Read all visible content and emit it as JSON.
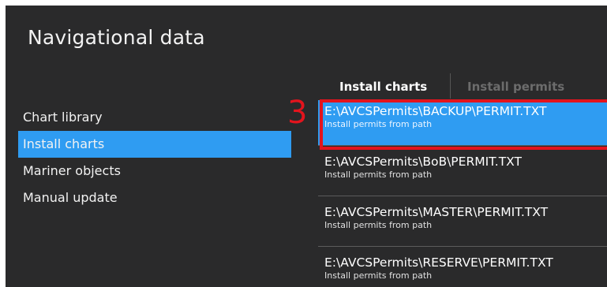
{
  "window": {
    "title": "Navigational data"
  },
  "nav": {
    "items": [
      {
        "label": "Chart library",
        "active": false
      },
      {
        "label": "Install charts",
        "active": true
      },
      {
        "label": "Mariner objects",
        "active": false
      },
      {
        "label": "Manual update",
        "active": false
      }
    ]
  },
  "tabs": [
    {
      "label": "Install charts",
      "active": true
    },
    {
      "label": "Install permits",
      "active": false
    }
  ],
  "permits": [
    {
      "path": "E:\\AVCSPermits\\BACKUP\\PERMIT.TXT",
      "subtitle": "Install permits from path",
      "selected": true
    },
    {
      "path": "E:\\AVCSPermits\\BoB\\PERMIT.TXT",
      "subtitle": "Install permits from path",
      "selected": false
    },
    {
      "path": "E:\\AVCSPermits\\MASTER\\PERMIT.TXT",
      "subtitle": "Install permits from path",
      "selected": false
    },
    {
      "path": "E:\\AVCSPermits\\RESERVE\\PERMIT.TXT",
      "subtitle": "Install permits from path",
      "selected": false
    }
  ],
  "annotation": {
    "step": "3",
    "color": "#e3141d"
  },
  "colors": {
    "background": "#2a2a2b",
    "accent": "#2f9cf2"
  }
}
